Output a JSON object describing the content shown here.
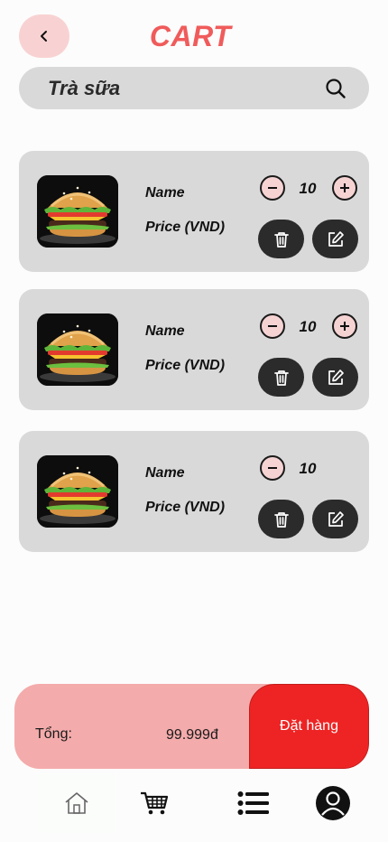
{
  "header": {
    "title": "CART"
  },
  "search": {
    "value": "Trà sữa"
  },
  "cart": {
    "items": [
      {
        "name": "Name",
        "price": "Price (VND)",
        "quantity": "10"
      },
      {
        "name": "Name",
        "price": "Price (VND)",
        "quantity": "10"
      },
      {
        "name": "Name",
        "price": "Price (VND)",
        "quantity": "10"
      }
    ]
  },
  "checkout": {
    "total_label": "Tổng:",
    "total_value": "99.999đ",
    "order_label": "Đặt hàng"
  },
  "nav": {
    "items": [
      "home-icon",
      "cart-icon",
      "list-icon",
      "profile-icon"
    ]
  },
  "colors": {
    "accent": "#f05b5b",
    "order_button": "#ee2424",
    "checkout_bg": "#f4abab",
    "card_bg": "#d9d9d9"
  }
}
